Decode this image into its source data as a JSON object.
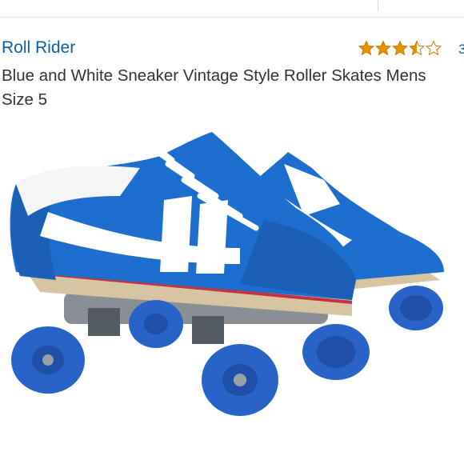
{
  "product": {
    "brand": "Roll Rider",
    "title": "Blue and White Sneaker Vintage Style Roller Skates Mens Size 5",
    "rating": {
      "stars": 3.5,
      "max": 5,
      "star_color": "#e59200",
      "count_visible": "3"
    },
    "image": {
      "description_icon": "roller-skates-photo",
      "colors": {
        "shoe_blue": "#1e6ed0",
        "stripe_white": "#ffffff",
        "wheel_blue": "#2a63c8",
        "sole_red": "#c8323a"
      }
    }
  }
}
